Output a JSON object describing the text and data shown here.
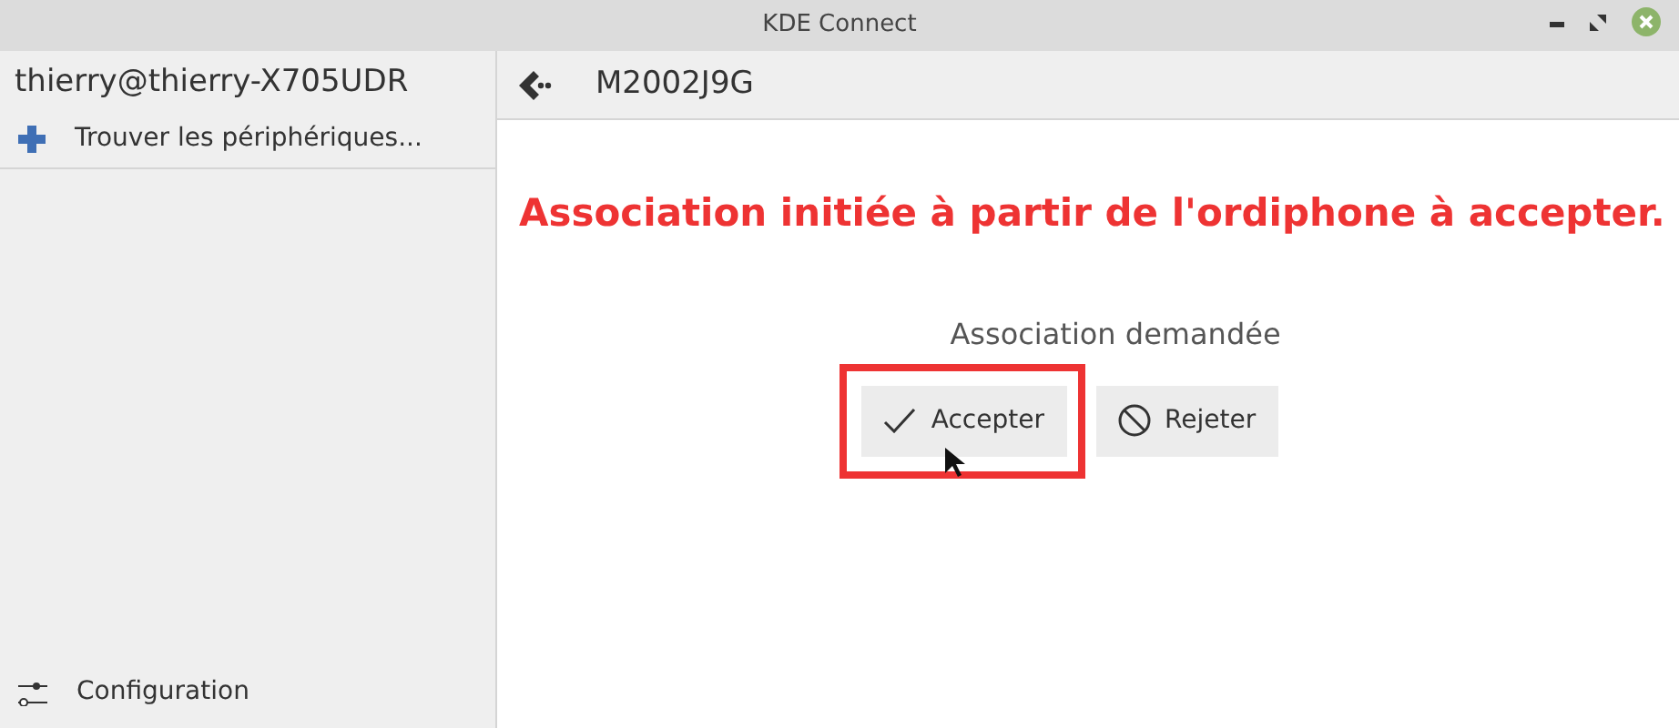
{
  "window": {
    "title": "KDE Connect"
  },
  "sidebar": {
    "host": "thierry@thierry-X705UDR",
    "find_action": "Trouver les périphériques...",
    "settings_action": "Configuration"
  },
  "device": {
    "name": "M2002J9G"
  },
  "annotation": {
    "text": "Association initiée à partir de l'ordiphone à accepter.",
    "color": "#ee3333"
  },
  "pairing": {
    "status": "Association demandée",
    "buttons": [
      {
        "kind": "accept",
        "label": "Accepter",
        "highlighted": true
      },
      {
        "kind": "reject",
        "label": "Rejeter",
        "highlighted": false
      }
    ]
  }
}
